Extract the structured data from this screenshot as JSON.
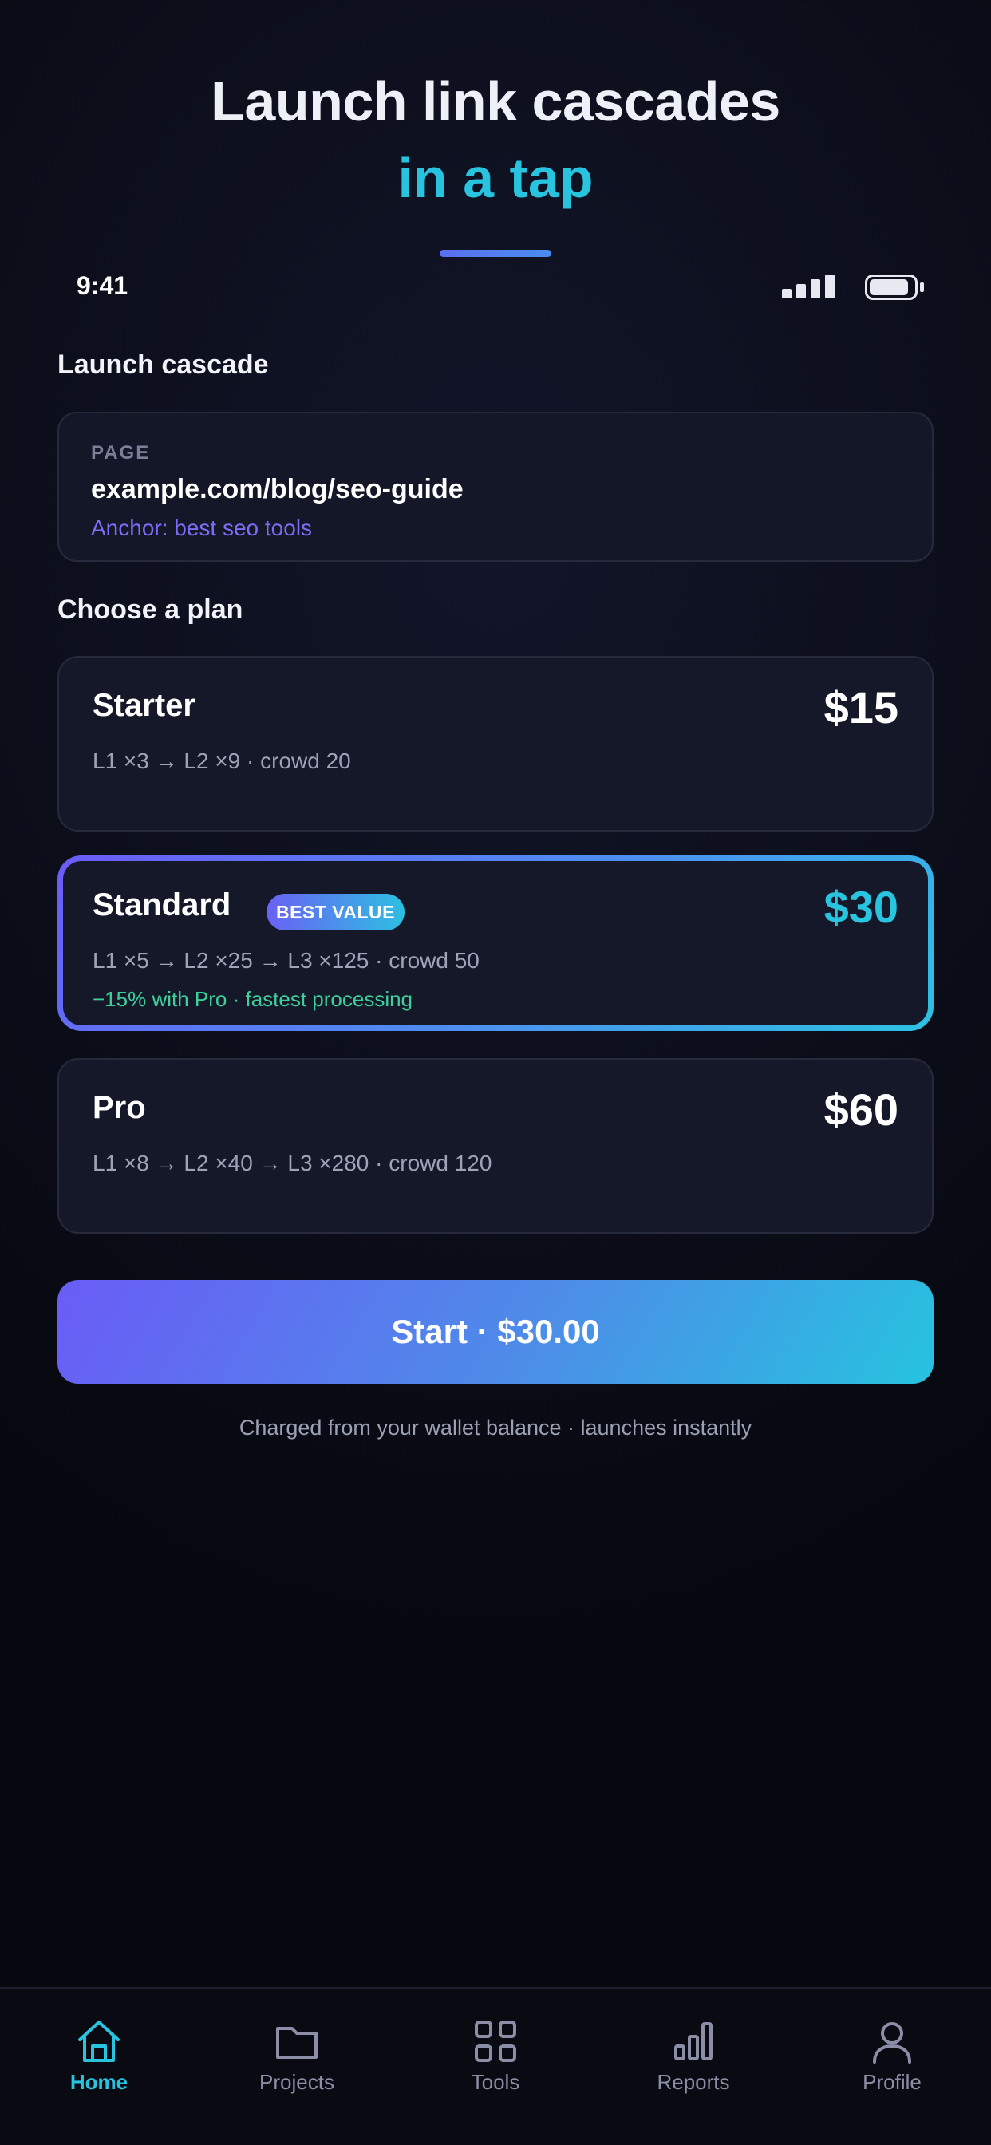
{
  "hero": {
    "line1": "Launch link cascades",
    "line2": "in a tap"
  },
  "status_bar": {
    "time": "9:41"
  },
  "launch": {
    "section_title": "Launch cascade",
    "page_label": "PAGE",
    "page_url": "example.com/blog/seo-guide",
    "anchor": "Anchor: best seo tools"
  },
  "plans_section_title": "Choose a plan",
  "plans": [
    {
      "name": "Starter",
      "price": "$15",
      "description": "L1 ×3 → L2 ×9 · crowd 20"
    },
    {
      "name": "Standard",
      "price": "$30",
      "badge": "BEST VALUE",
      "description": "L1 ×5 → L2 ×25 → L3 ×125 · crowd 50",
      "note": "−15% with Pro · fastest processing",
      "selected": true
    },
    {
      "name": "Pro",
      "price": "$60",
      "description": "L1 ×8 → L2 ×40 → L3 ×280 · crowd 120"
    }
  ],
  "cta": {
    "label": "Start · $30.00",
    "note": "Charged from your wallet balance · launches instantly"
  },
  "tabbar": {
    "active": "Home",
    "items": [
      {
        "label": "Home",
        "icon": "home-icon"
      },
      {
        "label": "Projects",
        "icon": "folder-icon"
      },
      {
        "label": "Tools",
        "icon": "grid-icon"
      },
      {
        "label": "Reports",
        "icon": "bar-chart-icon"
      },
      {
        "label": "Profile",
        "icon": "user-icon"
      }
    ]
  },
  "colors": {
    "accent_cyan": "#27c3df",
    "accent_purple": "#6a5cf6",
    "success_green": "#3ecf9b",
    "background": "#0c0e1b"
  }
}
